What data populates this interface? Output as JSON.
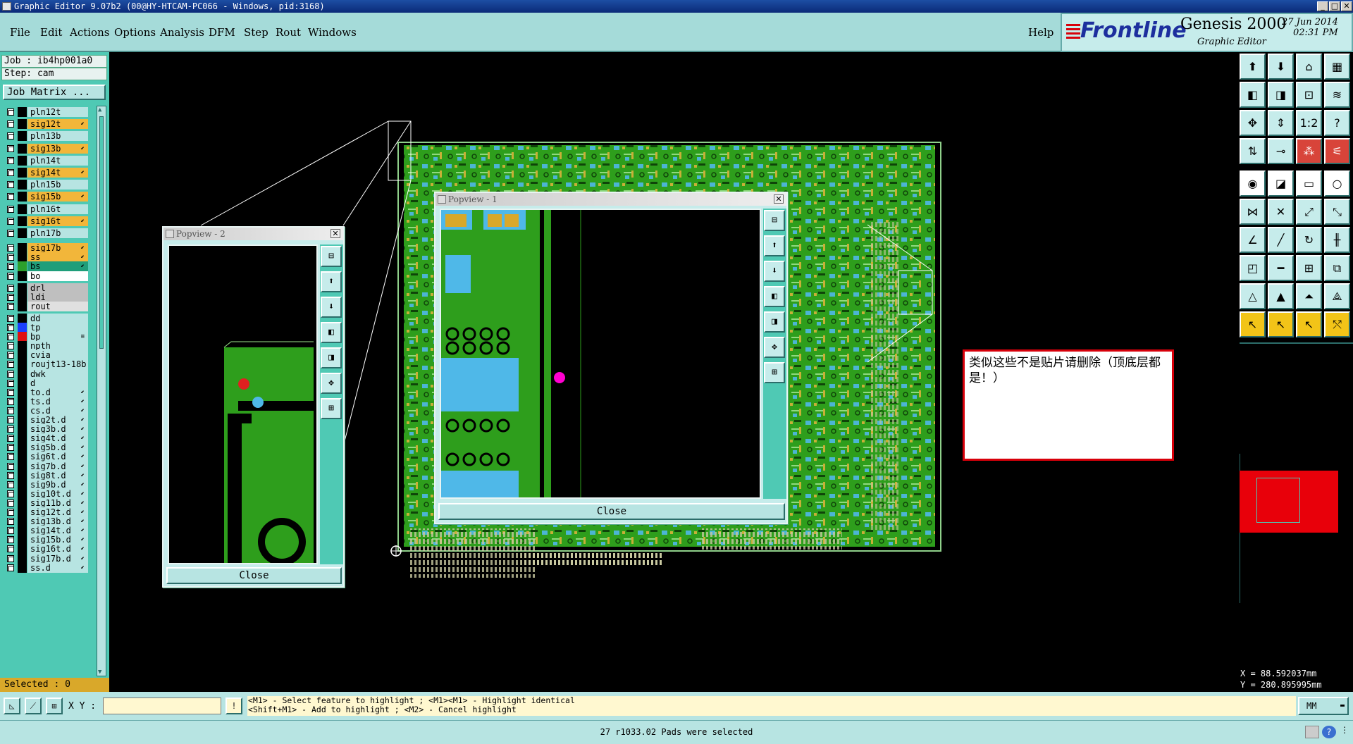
{
  "window": {
    "title": "Graphic Editor 9.07b2 (00@HY-HTCAM-PC066 - Windows, pid:3168)",
    "min": "_",
    "max": "□",
    "close": "✕"
  },
  "menu": [
    {
      "label": "File"
    },
    {
      "label": "Edit"
    },
    {
      "label": "Actions"
    },
    {
      "label": "Options"
    },
    {
      "label": "Analysis"
    },
    {
      "label": "DFM"
    },
    {
      "label": "Step"
    },
    {
      "label": "Rout"
    },
    {
      "label": "Windows"
    }
  ],
  "help_label": "Help",
  "brand": {
    "logo": "Frontline",
    "product": "Genesis 2000",
    "subtitle": "Graphic Editor",
    "date": "27 Jun 2014",
    "time": "02:31 PM"
  },
  "job": {
    "job_line": "Job : ib4hp001a0",
    "step_line": "Step: cam",
    "matrix_button": "Job Matrix ..."
  },
  "layers": [
    {
      "name": "pln12t",
      "bg": "#b7e4e2",
      "sw": "#000000",
      "ed": ""
    },
    {
      "name": "sig12t",
      "bg": "#f2b63a",
      "sw": "#000000",
      "ed": "⬋"
    },
    {
      "name": "pln13b",
      "bg": "#b7e4e2",
      "sw": "#000000",
      "ed": ""
    },
    {
      "name": "sig13b",
      "bg": "#f2b63a",
      "sw": "#000000",
      "ed": "⬋"
    },
    {
      "name": "pln14t",
      "bg": "#b7e4e2",
      "sw": "#000000",
      "ed": ""
    },
    {
      "name": "sig14t",
      "bg": "#f2b63a",
      "sw": "#000000",
      "ed": "⬋"
    },
    {
      "name": "pln15b",
      "bg": "#b7e4e2",
      "sw": "#000000",
      "ed": ""
    },
    {
      "name": "sig15b",
      "bg": "#f2b63a",
      "sw": "#000000",
      "ed": "⬋"
    },
    {
      "name": "pln16t",
      "bg": "#b7e4e2",
      "sw": "#000000",
      "ed": ""
    },
    {
      "name": "sig16t",
      "bg": "#f2b63a",
      "sw": "#000000",
      "ed": "⬋"
    },
    {
      "name": "pln17b",
      "bg": "#b7e4e2",
      "sw": "#000000",
      "ed": ""
    },
    {
      "name": "sig17b",
      "bg": "#f2b63a",
      "sw": "#000000",
      "ed": "⬋"
    },
    {
      "name": "ss",
      "bg": "#f2b63a",
      "sw": "#000000",
      "ed": "⬋"
    },
    {
      "name": "bs",
      "bg": "#1f9e7a",
      "sw": "#2ca02c",
      "ed": "⬋"
    },
    {
      "name": "bo",
      "bg": "#ffffff",
      "sw": "#000000",
      "ed": ""
    },
    {
      "name": "drl",
      "bg": "#bfbfbf",
      "sw": "#000000",
      "ed": ""
    },
    {
      "name": "ldi",
      "bg": "#bfbfbf",
      "sw": "#000000",
      "ed": ""
    },
    {
      "name": "rout",
      "bg": "#e0e0e0",
      "sw": "#000000",
      "ed": ""
    },
    {
      "name": "dd",
      "bg": "#b7e4e2",
      "sw": "#000000",
      "ed": ""
    },
    {
      "name": "tp",
      "bg": "#b7e4e2",
      "sw": "#1a3fff",
      "ed": ""
    },
    {
      "name": "bp",
      "bg": "#b7e4e2",
      "sw": "#e01010",
      "ed": "≡"
    },
    {
      "name": "npth",
      "bg": "#b7e4e2",
      "sw": "#000000",
      "ed": ""
    },
    {
      "name": "cvia",
      "bg": "#b7e4e2",
      "sw": "#000000",
      "ed": ""
    },
    {
      "name": "roujt13-18b",
      "bg": "#b7e4e2",
      "sw": "#000000",
      "ed": ""
    },
    {
      "name": "dwk",
      "bg": "#b7e4e2",
      "sw": "#000000",
      "ed": ""
    },
    {
      "name": "d",
      "bg": "#b7e4e2",
      "sw": "#000000",
      "ed": ""
    },
    {
      "name": "to.d",
      "bg": "#b7e4e2",
      "sw": "#000000",
      "ed": "⬋"
    },
    {
      "name": "ts.d",
      "bg": "#b7e4e2",
      "sw": "#000000",
      "ed": "⬋"
    },
    {
      "name": "cs.d",
      "bg": "#b7e4e2",
      "sw": "#000000",
      "ed": "⬋"
    },
    {
      "name": "sig2t.d",
      "bg": "#b7e4e2",
      "sw": "#000000",
      "ed": "⬋"
    },
    {
      "name": "sig3b.d",
      "bg": "#b7e4e2",
      "sw": "#000000",
      "ed": "⬋"
    },
    {
      "name": "sig4t.d",
      "bg": "#b7e4e2",
      "sw": "#000000",
      "ed": "⬋"
    },
    {
      "name": "sig5b.d",
      "bg": "#b7e4e2",
      "sw": "#000000",
      "ed": "⬋"
    },
    {
      "name": "sig6t.d",
      "bg": "#b7e4e2",
      "sw": "#000000",
      "ed": "⬋"
    },
    {
      "name": "sig7b.d",
      "bg": "#b7e4e2",
      "sw": "#000000",
      "ed": "⬋"
    },
    {
      "name": "sig8t.d",
      "bg": "#b7e4e2",
      "sw": "#000000",
      "ed": "⬋"
    },
    {
      "name": "sig9b.d",
      "bg": "#b7e4e2",
      "sw": "#000000",
      "ed": "⬋"
    },
    {
      "name": "sig10t.d",
      "bg": "#b7e4e2",
      "sw": "#000000",
      "ed": "⬋"
    },
    {
      "name": "sig11b.d",
      "bg": "#b7e4e2",
      "sw": "#000000",
      "ed": "⬋"
    },
    {
      "name": "sig12t.d",
      "bg": "#b7e4e2",
      "sw": "#000000",
      "ed": "⬋"
    },
    {
      "name": "sig13b.d",
      "bg": "#b7e4e2",
      "sw": "#000000",
      "ed": "⬋"
    },
    {
      "name": "sig14t.d",
      "bg": "#b7e4e2",
      "sw": "#000000",
      "ed": "⬋"
    },
    {
      "name": "sig15b.d",
      "bg": "#b7e4e2",
      "sw": "#000000",
      "ed": "⬋"
    },
    {
      "name": "sig16t.d",
      "bg": "#b7e4e2",
      "sw": "#000000",
      "ed": "⬋"
    },
    {
      "name": "sig17b.d",
      "bg": "#b7e4e2",
      "sw": "#000000",
      "ed": "⬋"
    },
    {
      "name": "ss.d",
      "bg": "#b7e4e2",
      "sw": "#000000",
      "ed": "⬋"
    }
  ],
  "selected_label": "Selected : 0",
  "popview1": {
    "title": "Popview - 1",
    "close_label": "Close"
  },
  "popview2": {
    "title": "Popview - 2",
    "close_label": "Close"
  },
  "note": {
    "text": "类似这些不是贴片请删除（顶底层都是！）"
  },
  "right_tools": [
    {
      "icon": "screen-up-icon",
      "g": "⬆",
      "c": ""
    },
    {
      "icon": "screen-down-icon",
      "g": "⬇",
      "c": ""
    },
    {
      "icon": "home-icon",
      "g": "⌂",
      "c": ""
    },
    {
      "icon": "grid-icon",
      "g": "▦",
      "c": ""
    },
    {
      "icon": "pan-left-icon",
      "g": "◧",
      "c": ""
    },
    {
      "icon": "pan-right-icon",
      "g": "◨",
      "c": ""
    },
    {
      "icon": "zoom-box-icon",
      "g": "⊡",
      "c": ""
    },
    {
      "icon": "redraw-icon",
      "g": "≋",
      "c": ""
    },
    {
      "icon": "fit-icon",
      "g": "✥",
      "c": ""
    },
    {
      "icon": "fit-vertical-icon",
      "g": "⇕",
      "c": ""
    },
    {
      "icon": "scale-one-two-icon",
      "g": "1:2",
      "c": ""
    },
    {
      "icon": "help-query-icon",
      "g": "?",
      "c": ""
    },
    {
      "icon": "sort-icon",
      "g": "⇅",
      "c": ""
    },
    {
      "icon": "probe-icon",
      "g": "⊸",
      "c": ""
    },
    {
      "icon": "net-icon",
      "g": "⁂",
      "c": "r"
    },
    {
      "icon": "tree-icon",
      "g": "⚟",
      "c": "r"
    },
    {
      "icon": "camera-icon",
      "g": "◉",
      "c": "w"
    },
    {
      "icon": "clipboard-icon",
      "g": "◪",
      "c": "w"
    },
    {
      "icon": "ruler-icon",
      "g": "▭",
      "c": "w"
    },
    {
      "icon": "circle-frame-icon",
      "g": "○",
      "c": "w"
    },
    {
      "icon": "connect-nodes-icon",
      "g": "⋈",
      "c": ""
    },
    {
      "icon": "cross-node-icon",
      "g": "✕",
      "c": ""
    },
    {
      "icon": "link-nodes-icon",
      "g": "⤢",
      "c": ""
    },
    {
      "icon": "branch-nodes-icon",
      "g": "⤡",
      "c": ""
    },
    {
      "icon": "angle-line-icon",
      "g": "∠",
      "c": ""
    },
    {
      "icon": "slash-line-icon",
      "g": "╱",
      "c": ""
    },
    {
      "icon": "arc-icon",
      "g": "↻",
      "c": ""
    },
    {
      "icon": "parallel-icon",
      "g": "╫",
      "c": ""
    },
    {
      "icon": "pad-add-icon",
      "g": "◰",
      "c": ""
    },
    {
      "icon": "line-add-icon",
      "g": "━",
      "c": ""
    },
    {
      "icon": "align-icon",
      "g": "⊞",
      "c": ""
    },
    {
      "icon": "copy-pad-icon",
      "g": "⧉",
      "c": ""
    },
    {
      "icon": "triangle-small-icon",
      "g": "△",
      "c": ""
    },
    {
      "icon": "triangle-icon",
      "g": "▲",
      "c": ""
    },
    {
      "icon": "triangle-filled-icon",
      "g": "⏶",
      "c": ""
    },
    {
      "icon": "triangle-outline-icon",
      "g": "⟁",
      "c": ""
    },
    {
      "icon": "pointer-icon",
      "g": "↖",
      "c": "y"
    },
    {
      "icon": "pointer-select-icon",
      "g": "↖",
      "c": "y"
    },
    {
      "icon": "pointer-move-icon",
      "g": "↖",
      "c": "y"
    },
    {
      "icon": "pointer-route-icon",
      "g": "⤲",
      "c": "y"
    }
  ],
  "coords": {
    "x": "X = 88.592037mm",
    "y": "Y = 280.895995mm"
  },
  "bottom": {
    "xy_label": "X Y :",
    "xy_value": "",
    "hint1": "<M1> - Select feature to highlight ; <M1><M1> - Highlight identical",
    "hint2": "<Shift+M1> - Add to highlight ; <M2> - Cancel highlight",
    "unit": "MM",
    "status": "27 r1033.02 Pads were selected"
  },
  "colors": {
    "board": "#2e9e1c",
    "pad_cyan": "#4fb8e8",
    "mark_red": "#e02020",
    "mark_magenta": "#ff00d0",
    "note_border": "#d8000a"
  }
}
